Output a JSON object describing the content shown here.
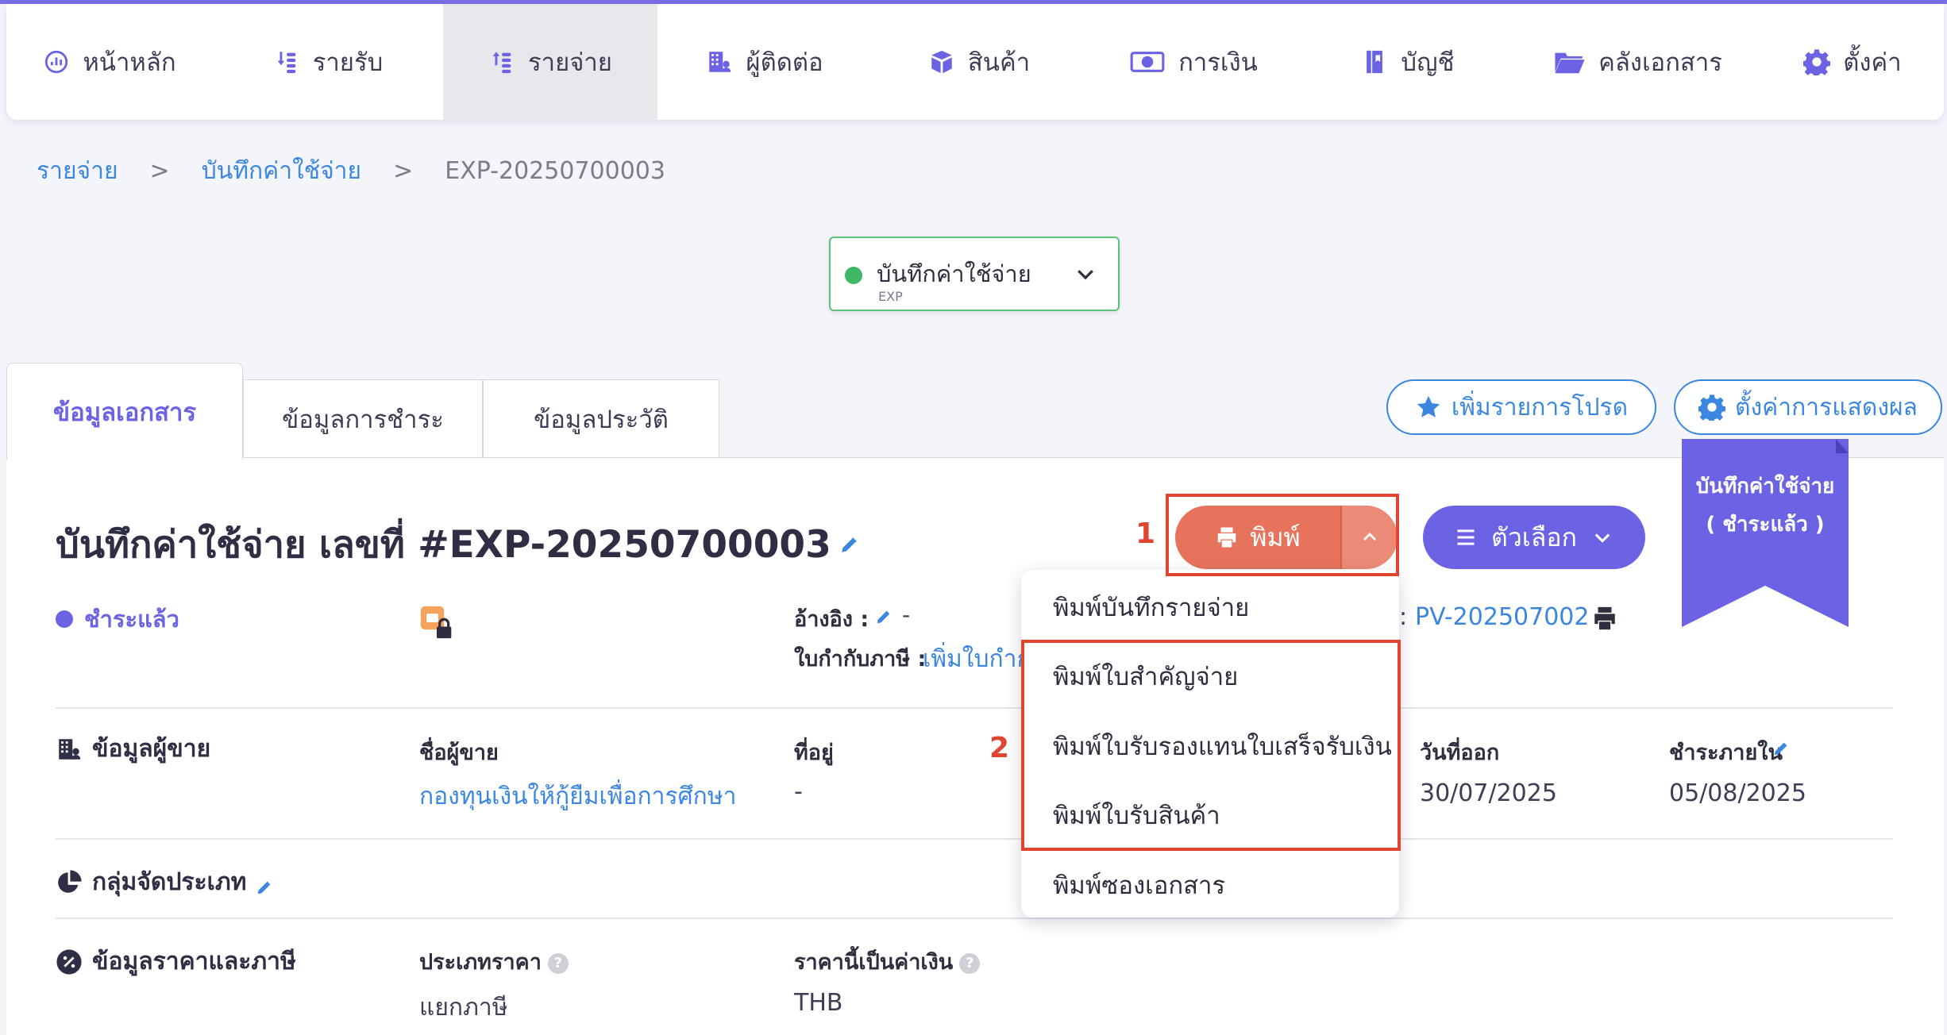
{
  "nav": {
    "items": [
      {
        "label": "หน้าหลัก",
        "icon": "dashboard-icon"
      },
      {
        "label": "รายรับ",
        "icon": "income-icon"
      },
      {
        "label": "รายจ่าย",
        "icon": "expense-icon",
        "active": true
      },
      {
        "label": "ผู้ติดต่อ",
        "icon": "contacts-icon"
      },
      {
        "label": "สินค้า",
        "icon": "box-icon"
      },
      {
        "label": "การเงิน",
        "icon": "money-icon"
      },
      {
        "label": "บัญชี",
        "icon": "book-icon"
      },
      {
        "label": "คลังเอกสาร",
        "icon": "folder-icon"
      },
      {
        "label": "ตั้งค่า",
        "icon": "gear-icon"
      }
    ]
  },
  "breadcrumb": {
    "level1": "รายจ่าย",
    "level2": "บันทึกค่าใช้จ่าย",
    "current": "EXP-20250700003",
    "separator": ">"
  },
  "status_dropdown": {
    "title": "บันทึกค่าใช้จ่าย",
    "sub": "EXP"
  },
  "tabs": [
    {
      "label": "ข้อมูลเอกสาร",
      "active": true
    },
    {
      "label": "ข้อมูลการชำระ"
    },
    {
      "label": "ข้อมูลประวัติ"
    }
  ],
  "actions": {
    "favorite": "เพิ่มรายการโปรด",
    "display_settings": "ตั้งค่าการแสดงผล"
  },
  "ribbon": {
    "line1": "บันทึกค่าใช้จ่าย",
    "line2": "( ชำระแล้ว )"
  },
  "document": {
    "title": "บันทึกค่าใช้จ่าย เลขที่ #EXP-20250700003",
    "status": "ชำระแล้ว",
    "reference_label": "อ้างอิง :",
    "reference_value": "-",
    "tax_invoice_label": "ใบกำกับภาษี :",
    "tax_invoice_link": "เพิ่มใบกำกั",
    "pv_label": ":",
    "pv_value": "PV-202507002"
  },
  "print_button": {
    "label": "พิมพ์"
  },
  "options_button": {
    "label": "ตัวเลือก"
  },
  "print_menu": {
    "items": [
      "พิมพ์บันทึกรายจ่าย",
      "พิมพ์ใบสำคัญจ่าย",
      "พิมพ์ใบรับรองแทนใบเสร็จรับเงิน",
      "พิมพ์ใบรับสินค้า",
      "พิมพ์ซองเอกสาร"
    ]
  },
  "annotations": {
    "step1": "1",
    "step2": "2"
  },
  "vendor": {
    "section": "ข้อมูลผู้ขาย",
    "name_label": "ชื่อผู้ขาย",
    "name_value": "กองทุนเงินให้กู้ยืมเพื่อการศึกษา",
    "address_label": "ที่อยู่",
    "address_value": "-",
    "issue_date_label": "วันที่ออก",
    "issue_date_value": "30/07/2025",
    "due_label": "ชำระภายใน",
    "due_value": "05/08/2025"
  },
  "category": {
    "section": "กลุ่มจัดประเภท"
  },
  "pricing": {
    "section": "ข้อมูลราคาและภาษี",
    "price_type_label": "ประเภทราคา",
    "price_type_value": "แยกภาษี",
    "currency_label": "ราคานี้เป็นค่าเงิน",
    "currency_value": "THB"
  },
  "colors": {
    "accent": "#6c63e4",
    "link": "#3a86e0",
    "print": "#e8735c",
    "annotation": "#e0462f",
    "status_green": "#3fb866"
  }
}
